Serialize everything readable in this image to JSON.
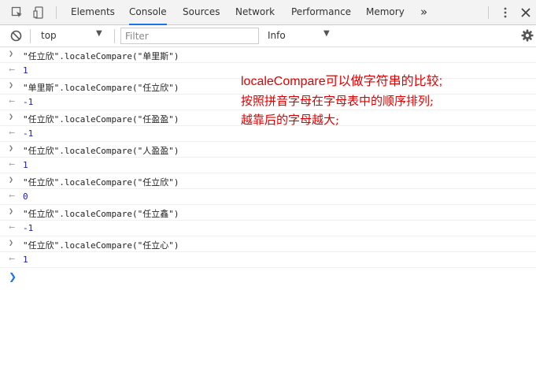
{
  "tabs": [
    {
      "label": "Elements",
      "active": false
    },
    {
      "label": "Console",
      "active": true
    },
    {
      "label": "Sources",
      "active": false
    },
    {
      "label": "Network",
      "active": false
    },
    {
      "label": "Performance",
      "active": false
    },
    {
      "label": "Memory",
      "active": false
    }
  ],
  "more_tabs": "»",
  "toolbar": {
    "context": "top",
    "filter_placeholder": "Filter",
    "level": "Info"
  },
  "console": {
    "entries": [
      {
        "input": "\"任立欣\".localeCompare(\"单里斯\")",
        "output": "1"
      },
      {
        "input": "\"单里斯\".localeCompare(\"任立欣\")",
        "output": "-1"
      },
      {
        "input": "\"任立欣\".localeCompare(\"任盈盈\")",
        "output": "-1"
      },
      {
        "input": "\"任立欣\".localeCompare(\"人盈盈\")",
        "output": "1"
      },
      {
        "input": "\"任立欣\".localeCompare(\"任立欣\")",
        "output": "0"
      },
      {
        "input": "\"任立欣\".localeCompare(\"任立鑫\")",
        "output": "-1"
      },
      {
        "input": "\"任立欣\".localeCompare(\"任立心\")",
        "output": "1"
      }
    ]
  },
  "annotation": {
    "line1": "localeCompare可以做字符串的比较;",
    "line2": "按照拼音字母在字母表中的顺序排列;",
    "line3": "越靠后的字母越大;"
  },
  "colors": {
    "accent": "#1a73e8",
    "annotation": "#e00000",
    "output_number": "#1a1aa6"
  }
}
